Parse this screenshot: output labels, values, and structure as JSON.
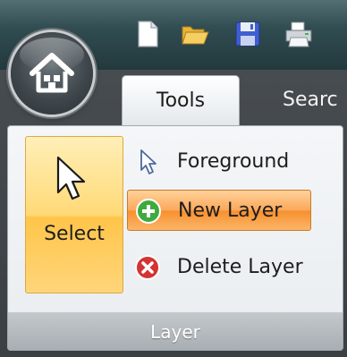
{
  "tabs": [
    {
      "label": "Tools",
      "active": true
    },
    {
      "label": "Searc",
      "active": false
    }
  ],
  "quick_access": [
    {
      "icon": "new-document-icon"
    },
    {
      "icon": "open-folder-icon"
    },
    {
      "icon": "save-disk-icon"
    },
    {
      "icon": "print-icon"
    }
  ],
  "app_button": {
    "icon": "home-icon"
  },
  "group": {
    "label": "Layer",
    "large_button": {
      "label": "Select",
      "icon": "arrow-cursor-icon"
    },
    "buttons": [
      {
        "label": "Foreground",
        "icon": "pointer-icon",
        "state": "normal"
      },
      {
        "label": "New Layer",
        "icon": "add-circle-icon",
        "state": "hover"
      },
      {
        "label": "Delete Layer",
        "icon": "delete-circle-icon",
        "state": "normal"
      }
    ]
  },
  "colors": {
    "titlebar": "#2f4b50",
    "ribbon_dark": "#3a3f43",
    "hover_accent": "#f7902e",
    "select_accent": "#ffc54a",
    "add_green": "#3faa3f",
    "delete_red": "#d43434"
  }
}
